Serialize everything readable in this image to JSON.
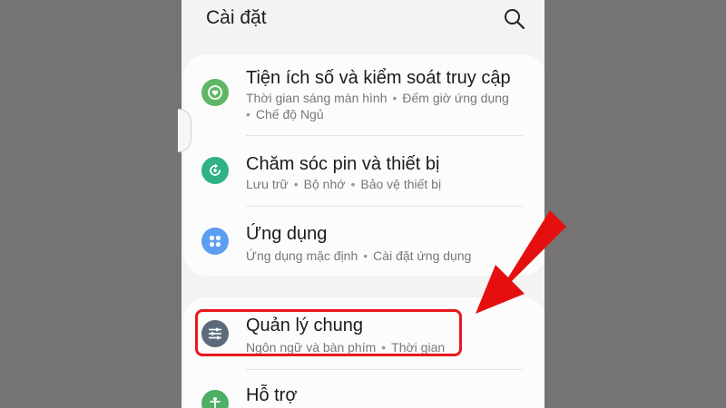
{
  "header": {
    "title": "Cài đặt"
  },
  "colors": {
    "background": "#757373",
    "screen": "#f3f3f3",
    "card": "#fcfcfc",
    "highlight": "#e8191e",
    "arrow": "#e60f0f",
    "digital_icon": "#5fb664",
    "battery_icon": "#2fb385",
    "apps_icon": "#5b9df0",
    "general_icon": "#5b6b7c",
    "support_icon": "#4caf64"
  },
  "groups": [
    {
      "items": [
        {
          "icon": "heart-circle-icon",
          "title": "Tiện ích số và kiểm soát truy cập",
          "subtitle": [
            "Thời gian sáng màn hình",
            "Đếm giờ ứng dụng",
            "Chế độ Ngủ"
          ]
        },
        {
          "icon": "refresh-circle-icon",
          "title": "Chăm sóc pin và thiết bị",
          "subtitle": [
            "Lưu trữ",
            "Bộ nhớ",
            "Bảo vệ thiết bị"
          ]
        },
        {
          "icon": "apps-grid-icon",
          "title": "Ứng dụng",
          "subtitle": [
            "Ứng dụng mặc định",
            "Cài đặt ứng dụng"
          ]
        }
      ]
    },
    {
      "items": [
        {
          "icon": "sliders-icon",
          "title": "Quản lý chung",
          "subtitle": [
            "Ngôn ngữ và bàn phím",
            "Thời gian"
          ]
        },
        {
          "icon": "person-help-icon",
          "title": "Hỗ trợ",
          "subtitle": []
        }
      ]
    }
  ],
  "separator": "•"
}
